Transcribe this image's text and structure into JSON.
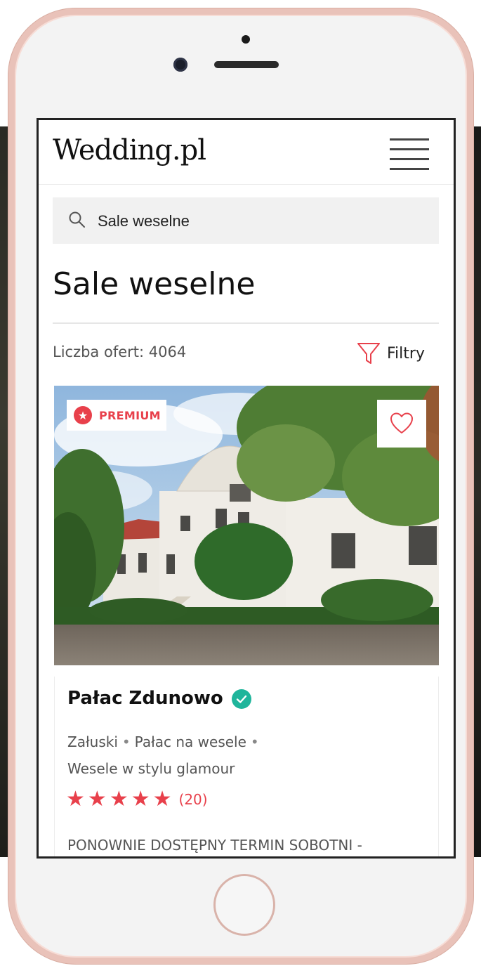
{
  "app": {
    "logo": "Wedding.pl"
  },
  "search": {
    "value": "Sale weselne",
    "placeholder": ""
  },
  "page": {
    "title": "Sale weselne",
    "offer_count": "Liczba ofert: 4064",
    "filters_label": "Filtry"
  },
  "listing": {
    "badge": "PREMIUM",
    "name": "Pałac Zdunowo",
    "location": "Załuski",
    "dot1": "•",
    "category": "Pałac na wesele",
    "dot2": "•",
    "style": "Wesele w stylu glamour",
    "rating": 5,
    "reviews": "(20)",
    "description": "PONOWNIE DOSTĘPNY TERMIN SOBOTNI -"
  },
  "colors": {
    "accent_red": "#e8404b",
    "verified_teal": "#1fb59b",
    "phone_frame": "#e9c2b9"
  },
  "icons": {
    "search": "search-icon",
    "menu": "hamburger-menu-icon",
    "filter": "funnel-icon",
    "favorite": "heart-outline-icon",
    "premium": "star-badge-icon",
    "verified": "check-circle-icon"
  }
}
